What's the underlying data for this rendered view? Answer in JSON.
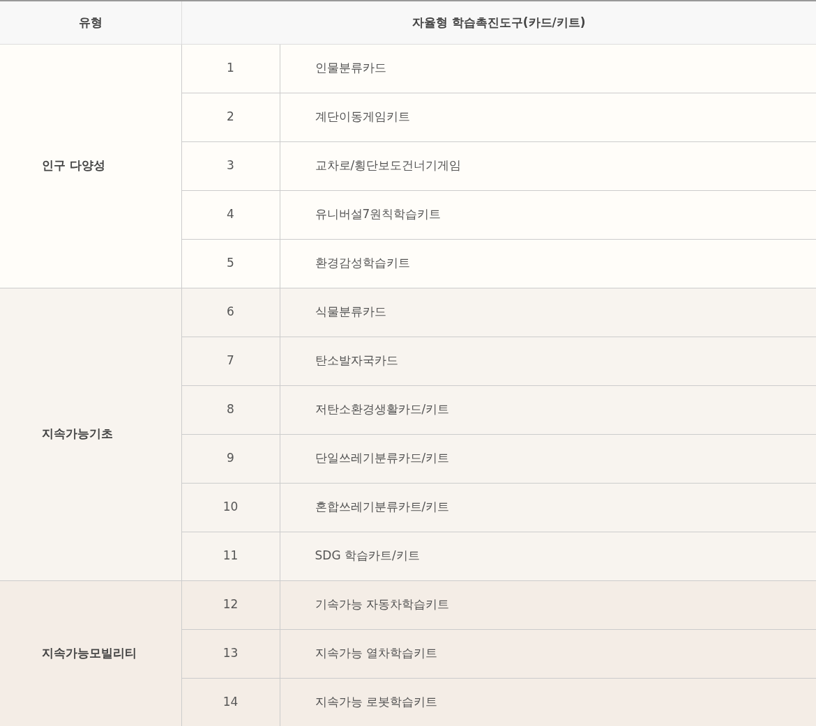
{
  "table": {
    "columns": [
      "유형",
      "자율형 학습촉진도구(카드/키트)"
    ],
    "groups": [
      {
        "type": "인구 다양성",
        "color": "#fffdf9",
        "rows": [
          {
            "no": "1",
            "tool": "인물분류카드"
          },
          {
            "no": "2",
            "tool": "계단이동게임키트"
          },
          {
            "no": "3",
            "tool": "교차로/횡단보도건너기게임"
          },
          {
            "no": "4",
            "tool": "유니버설7원칙학습키트"
          },
          {
            "no": "5",
            "tool": "환경감성학습키트"
          }
        ]
      },
      {
        "type": "지속가능기초",
        "color": "#f8f4ef",
        "rows": [
          {
            "no": "6",
            "tool": "식물분류카드"
          },
          {
            "no": "7",
            "tool": "탄소발자국카드"
          },
          {
            "no": "8",
            "tool": "저탄소환경생활카드/키트"
          },
          {
            "no": "9",
            "tool": "단일쓰레기분류카드/키트"
          },
          {
            "no": "10",
            "tool": "혼합쓰레기분류카트/키트"
          },
          {
            "no": "11",
            "tool": "SDG 학습카트/키트"
          }
        ]
      },
      {
        "type": "지속가능모빌리티",
        "color": "#f4ede6",
        "rows": [
          {
            "no": "12",
            "tool": "기속가능 자동차학습키트"
          },
          {
            "no": "13",
            "tool": "지속가능 열차학습키트"
          },
          {
            "no": "14",
            "tool": "지속가능 로봇학습키트"
          }
        ]
      }
    ]
  }
}
